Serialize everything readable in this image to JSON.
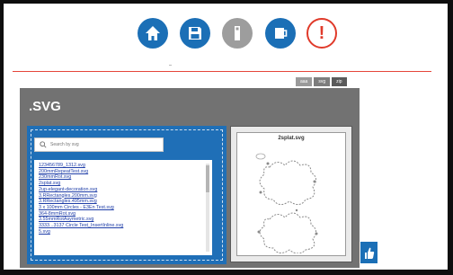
{
  "toolbar": {
    "buttons": [
      {
        "name": "home",
        "icon": "home-icon",
        "color": "#1b6fb6"
      },
      {
        "name": "save",
        "icon": "floppy-disk-icon",
        "color": "#1b6fb6"
      },
      {
        "name": "sd-card",
        "icon": "sd-card-icon",
        "color": "#9d9d9d"
      },
      {
        "name": "mug",
        "icon": "mug-icon",
        "color": "#1b6fb6"
      },
      {
        "name": "warning",
        "icon": "warning-icon",
        "color": "#e03a2a",
        "label": "!"
      }
    ]
  },
  "format_tabs": [
    {
      "label": "aaa"
    },
    {
      "label": "svg",
      "selected": true
    },
    {
      "label": "zip"
    }
  ],
  "panel": {
    "title": ".SVG",
    "search": {
      "placeholder": "Search by svg"
    },
    "files": [
      "123456789_1312.svg",
      "200mmRepeatTest.svg",
      "230mmRot.svg",
      "2splat.svg",
      "2up-elegant-decoration.svg",
      "3.RRectangles.200mm.svg",
      "3.RRectangles.495mm.svg",
      "3 x 100mm Circles - E3En Test.svg",
      "364-8mmRot.svg",
      "3.55mmRotAsymetric.svg",
      "3333...3137 Circle Test_InsertInline.svg",
      "5.svg"
    ],
    "preview": {
      "title": "2splat.svg"
    }
  },
  "colors": {
    "accent": "#1b6fb6",
    "alert": "#e03a2a",
    "panel_bg": "#727272",
    "link": "#1f3ea8"
  }
}
